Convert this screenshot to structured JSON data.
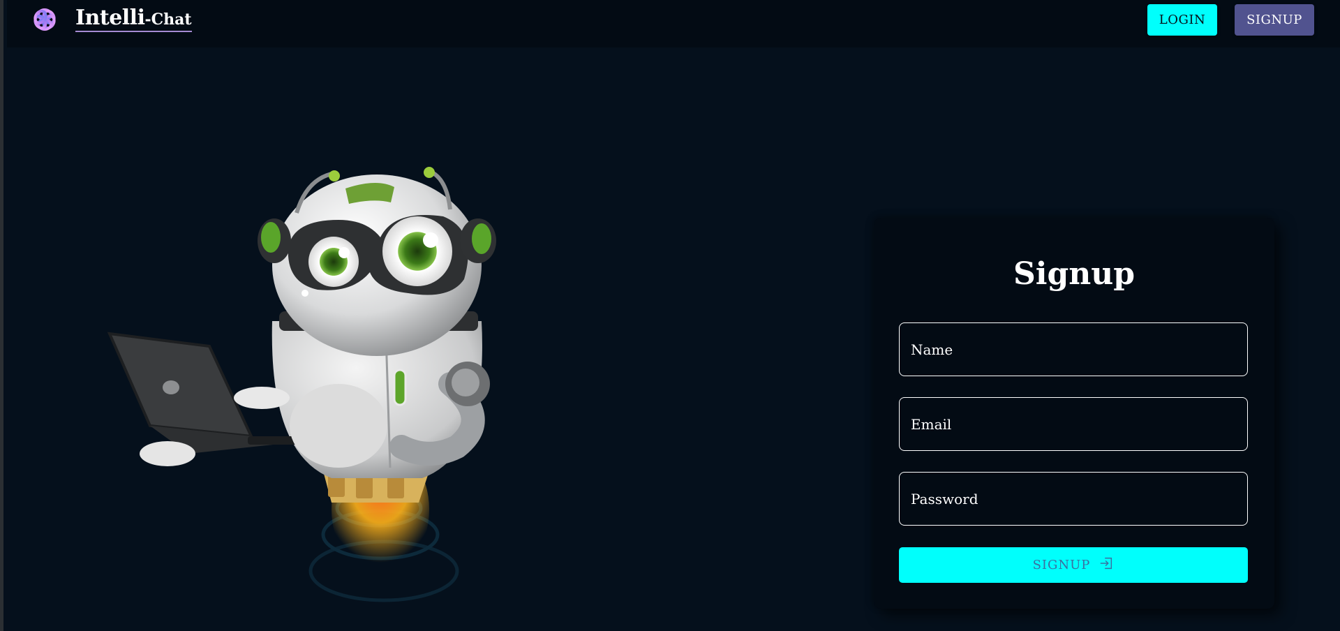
{
  "brand": {
    "name_main": "Intelli",
    "name_sub": "-Chat",
    "logo_icon": "openai-swirl-logo"
  },
  "header": {
    "login_label": "LOGIN",
    "signup_label": "SIGNUP"
  },
  "hero": {
    "image": "robot-with-laptop-illustration"
  },
  "signup_form": {
    "title": "Signup",
    "name_placeholder": "Name",
    "email_placeholder": "Email",
    "password_placeholder": "Password",
    "submit_label": "SIGNUP",
    "submit_icon": "login-arrow-icon"
  },
  "colors": {
    "accent": "#00fffc",
    "secondary": "#51538f",
    "background": "#05101c",
    "card": "#030b14"
  }
}
